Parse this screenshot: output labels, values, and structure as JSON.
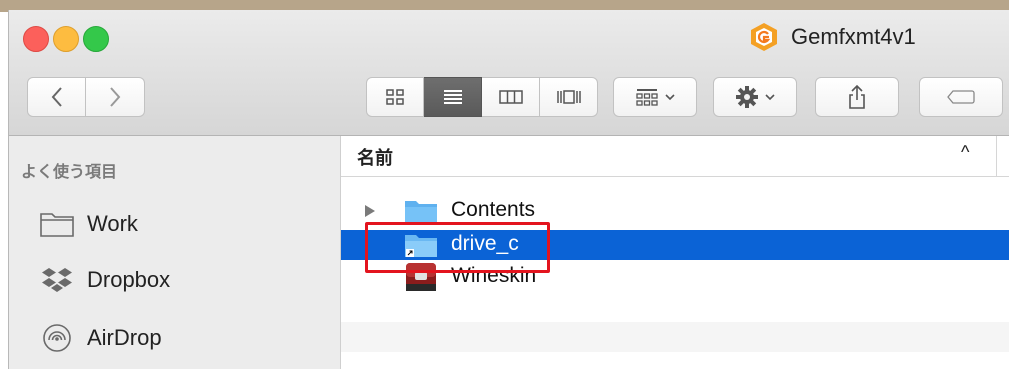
{
  "window": {
    "title": "Gemfxmt4v1",
    "accent_color": "#0b63d6",
    "highlight_color": "#e3141e"
  },
  "toolbar": {
    "nav": {
      "back": "chevron-left-icon",
      "forward": "chevron-right-icon"
    },
    "views": [
      {
        "icon": "icon-view-icon",
        "active": false
      },
      {
        "icon": "list-view-icon",
        "active": true
      },
      {
        "icon": "column-view-icon",
        "active": false
      },
      {
        "icon": "cover-flow-icon",
        "active": false
      }
    ],
    "arrange_icon": "group-icon",
    "action_icon": "gear-icon",
    "share_icon": "share-icon",
    "tag_icon": "tag-icon"
  },
  "sidebar": {
    "heading": "よく使う項目",
    "items": [
      {
        "label": "Work",
        "icon": "folder-icon"
      },
      {
        "label": "Dropbox",
        "icon": "dropbox-icon"
      },
      {
        "label": "AirDrop",
        "icon": "airdrop-icon"
      }
    ]
  },
  "list": {
    "column_name": "名前",
    "sort_indicator": "^",
    "rows": [
      {
        "label": "Contents",
        "icon": "folder-icon",
        "expandable": true,
        "selected": false
      },
      {
        "label": "drive_c",
        "icon": "alias-folder-icon",
        "expandable": false,
        "selected": true
      },
      {
        "label": "Wineskin",
        "icon": "app-icon",
        "expandable": false,
        "selected": false
      }
    ]
  }
}
